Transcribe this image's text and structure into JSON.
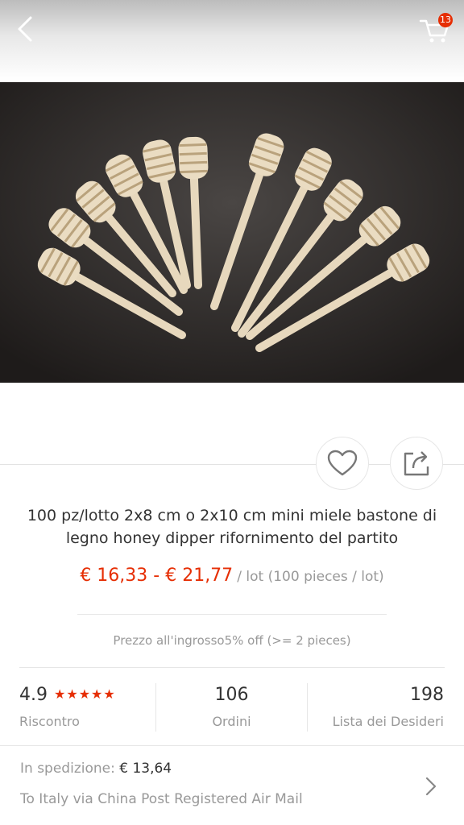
{
  "header": {
    "back_icon": "chevron-left-icon",
    "cart_icon": "cart-icon",
    "cart_count": "13"
  },
  "gallery": {
    "image_description": "ten wooden honey dipper sticks fanned out on a dark background"
  },
  "actions": {
    "favorite_icon": "heart-icon",
    "share_icon": "share-icon"
  },
  "product": {
    "title": "100 pz/lotto 2x8 cm o 2x10 cm mini miele bastone di legno honey dipper rifornimento del partito",
    "price_range": "€ 16,33 - € 21,77",
    "price_unit": "/ lot (100 pieces / lot)",
    "wholesale": "Prezzo all'ingrosso5% off (>= 2 pieces)"
  },
  "stats": {
    "rating_value": "4.9",
    "rating_stars": "★★★★★",
    "rating_label": "Riscontro",
    "orders_value": "106",
    "orders_label": "Ordini",
    "wishlist_value": "198",
    "wishlist_label": "Lista dei Desideri"
  },
  "shipping": {
    "label": "In spedizione:",
    "cost": "€ 13,64",
    "method": "To Italy via China Post Registered Air Mail"
  },
  "colors": {
    "accent": "#e62e04",
    "muted_text": "#999999",
    "main_text": "#333333"
  }
}
